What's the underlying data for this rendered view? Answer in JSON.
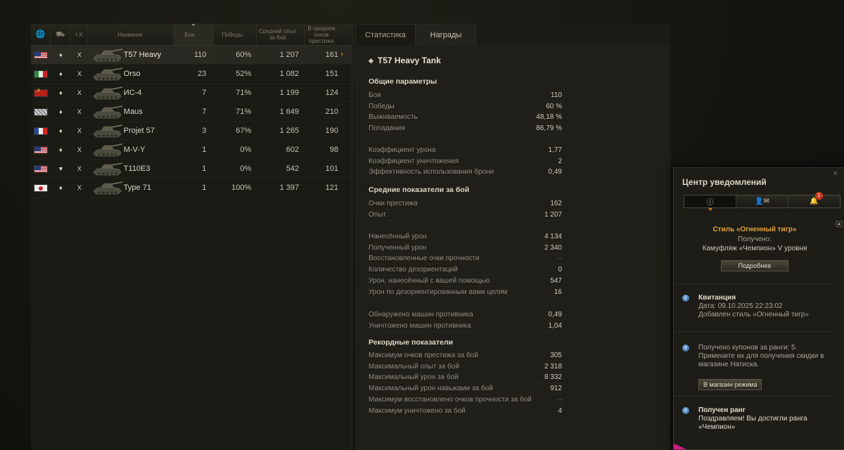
{
  "table": {
    "headers": {
      "tier": "I-X",
      "name": "Название",
      "battles": "Бои",
      "wins": "Победы",
      "avg_xp": "Средний опыт за бой",
      "avg_prestige": "В среднем очков престижа"
    },
    "rows": [
      {
        "nation": "usa",
        "type": "♦",
        "tier": "X",
        "name": "T57 Heavy",
        "battles": "110",
        "wins": "60%",
        "xp": "1 207",
        "prestige": "161",
        "selected": true
      },
      {
        "nation": "italy",
        "type": "♦",
        "tier": "X",
        "name": "Orso",
        "battles": "23",
        "wins": "52%",
        "xp": "1 082",
        "prestige": "151"
      },
      {
        "nation": "ussr",
        "type": "♦",
        "tier": "X",
        "name": "ИС-4",
        "battles": "7",
        "wins": "71%",
        "xp": "1 199",
        "prestige": "124"
      },
      {
        "nation": "germany",
        "type": "♦",
        "tier": "X",
        "name": "Maus",
        "battles": "7",
        "wins": "71%",
        "xp": "1 649",
        "prestige": "210"
      },
      {
        "nation": "france",
        "type": "♦",
        "tier": "X",
        "name": "Projet 57",
        "battles": "3",
        "wins": "67%",
        "xp": "1 265",
        "prestige": "190"
      },
      {
        "nation": "usa",
        "type": "♦",
        "tier": "X",
        "name": "M-V-Y",
        "battles": "1",
        "wins": "0%",
        "xp": "602",
        "prestige": "98"
      },
      {
        "nation": "usa",
        "type": "▼",
        "tier": "X",
        "name": "T110E3",
        "battles": "1",
        "wins": "0%",
        "xp": "542",
        "prestige": "101"
      },
      {
        "nation": "japan",
        "type": "♦",
        "tier": "X",
        "name": "Type 71",
        "battles": "1",
        "wins": "100%",
        "xp": "1 397",
        "prestige": "121"
      }
    ]
  },
  "stats": {
    "tabs": [
      "Статистика",
      "Награды"
    ],
    "vehicle_title": "T57 Heavy Tank",
    "general_header": "Общие параметры",
    "general": [
      {
        "label": "Бои",
        "value": "110"
      },
      {
        "label": "Победы",
        "value": "60 %"
      },
      {
        "label": "Выживаемость",
        "value": "48,18 %"
      },
      {
        "label": "Попадания",
        "value": "86,79 %"
      }
    ],
    "coef": [
      {
        "label": "Коэффициент урона",
        "value": "1,77"
      },
      {
        "label": "Коэффициент уничтожения",
        "value": "2"
      },
      {
        "label": "Эффективность использования брони",
        "value": "0,49"
      }
    ],
    "avg_header": "Средние показатели за бой",
    "avg1": [
      {
        "label": "Очки престижа",
        "value": "162"
      },
      {
        "label": "Опыт",
        "value": "1 207"
      }
    ],
    "avg2": [
      {
        "label": "Нанесённый урон",
        "value": "4 134"
      },
      {
        "label": "Полученный урон",
        "value": "2 340"
      },
      {
        "label": "Восстановленные очки прочности",
        "value": "--"
      },
      {
        "label": "Количество дезориентаций",
        "value": "0"
      },
      {
        "label": "Урон, нанесённый с вашей помощью",
        "value": "547"
      },
      {
        "label": "Урон по дезориентированным вами целям",
        "value": "16"
      }
    ],
    "avg3": [
      {
        "label": "Обнаружено машин противника",
        "value": "0,49"
      },
      {
        "label": "Уничтожено машин противника",
        "value": "1,04"
      }
    ],
    "record_header": "Рекордные показатели",
    "records": [
      {
        "label": "Максимум очков престижа за бой",
        "value": "305"
      },
      {
        "label": "Максимальный опыт за бой",
        "value": "2 318"
      },
      {
        "label": "Максимальный урон за бой",
        "value": "8 332"
      },
      {
        "label": "Максимальный урон навыками за бой",
        "value": "912"
      },
      {
        "label": "Максимум восстановлено очков прочности за бой",
        "value": "--"
      },
      {
        "label": "Максимум уничтожено за бой",
        "value": "4"
      }
    ]
  },
  "notifications": {
    "title": "Центр уведомлений",
    "badge": "1",
    "card1": {
      "title": "Стиль «Огненный тигр»",
      "line1": "Получено:",
      "line2": "Камуфляж «Чемпион» V уровня",
      "button": "Подробнее"
    },
    "card2": {
      "title": "Квитанция",
      "line1": "Дата: 09.10.2025 22:23:02",
      "line2": "Добавлен стиль «Огненный тигр»"
    },
    "card3": {
      "line1": "Получено купонов за ранги: 5.",
      "line2": "Примените их для получения скидки в",
      "line3": "магазине Натиска.",
      "button": "В магазин режима"
    },
    "card4": {
      "title": "Получен ранг",
      "line1": "Поздравляем! Вы достигли ранга",
      "line2": "«Чемпион»"
    }
  },
  "colors": {
    "accent_orange": "#e88a1a",
    "gold_text": "#e6a23c",
    "badge_red": "#c73a1a"
  }
}
